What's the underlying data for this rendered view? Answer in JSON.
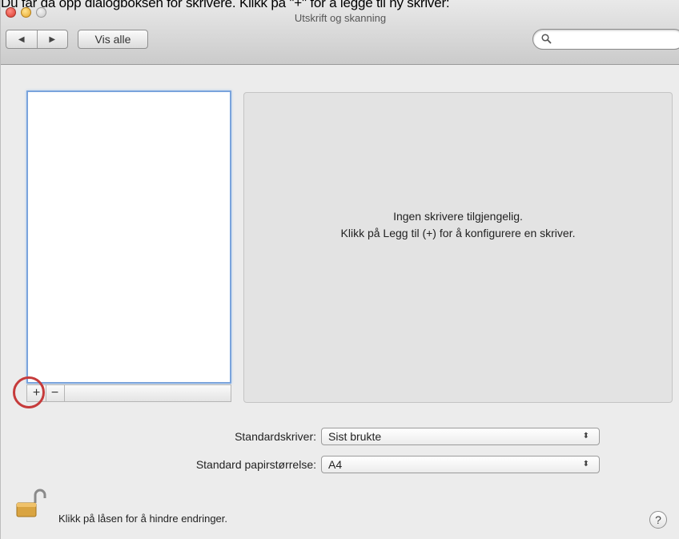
{
  "caption": "Du får da opp dialogboksen for skrivere. Klikk på \"+\" for å legge til ny skriver:",
  "window": {
    "title": "Utskrift og skanning",
    "back_icon": "◀",
    "forward_icon": "▶",
    "show_all_label": "Vis alle",
    "search_placeholder": ""
  },
  "printer_list": {
    "add_label": "+",
    "remove_label": "−"
  },
  "detail": {
    "empty_line1": "Ingen skrivere tilgjengelig.",
    "empty_line2": "Klikk på Legg til (+) for å konfigurere en skriver."
  },
  "settings": {
    "default_printer_label": "Standardskriver:",
    "default_printer_value": "Sist brukte",
    "paper_size_label": "Standard papirstørrelse:",
    "paper_size_value": "A4",
    "popup_arrows": "⬍"
  },
  "footer": {
    "lock_text": "Klikk på låsen for å hindre endringer.",
    "help_label": "?"
  },
  "colors": {
    "highlight_circle": "#c63b3b",
    "list_focus": "#7aa4dc"
  }
}
